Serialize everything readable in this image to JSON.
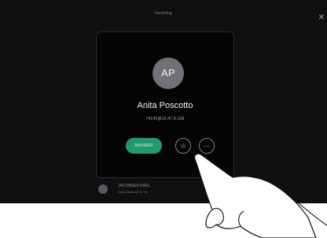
{
  "screen": {
    "title": "Incoming",
    "close_icon": "close-icon"
  },
  "call": {
    "avatar_initials": "AP",
    "caller_name": "Anita Poscotto",
    "caller_address": "74145@10.47.8.108",
    "answer_label": "ANSWER",
    "favorite_icon": "star-icon",
    "more_icon": "more-icon"
  },
  "bottom_item": {
    "line1": "JACOBSEN KARL",
    "line2": "Video Bahnhof 11 Tie"
  },
  "colors": {
    "answer": "#1f9b6d",
    "avatar": "#6f7277",
    "background": "#0e0f10"
  }
}
